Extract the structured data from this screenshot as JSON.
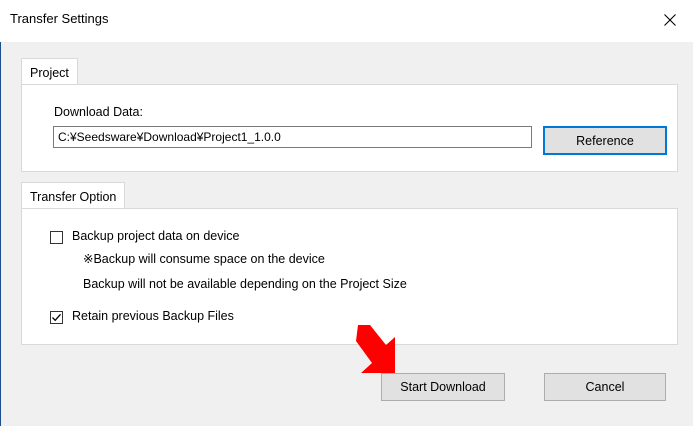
{
  "window": {
    "title": "Transfer Settings",
    "close_icon": "close-icon"
  },
  "project_tab": {
    "tab_label": "Project",
    "download_data_label": "Download Data:",
    "download_path": "C:¥Seedsware¥Download¥Project1_1.0.0",
    "reference_button": "Reference"
  },
  "transfer_option_tab": {
    "tab_label": "Transfer Option",
    "backup_checkbox_label": "Backup project data on device",
    "backup_checked": false,
    "note_line1": "※Backup will consume space on the device",
    "note_line2": "Backup will not be available depending on the Project Size",
    "retain_checkbox_label": "Retain previous Backup Files",
    "retain_checked": true
  },
  "buttons": {
    "start_download": "Start Download",
    "cancel": "Cancel"
  },
  "annotation": {
    "arrow_color": "#ff0000",
    "arrow_icon": "red-arrow-icon"
  }
}
